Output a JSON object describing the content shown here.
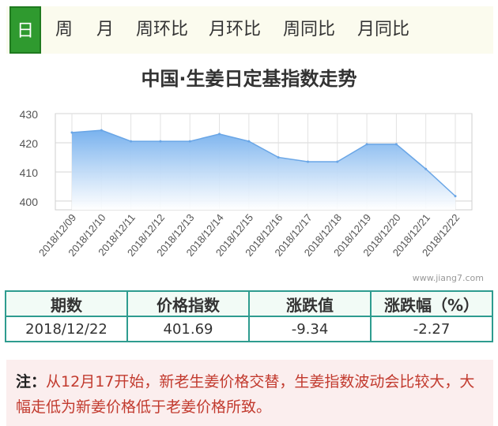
{
  "tabs": [
    {
      "label": "日",
      "active": true
    },
    {
      "label": "周",
      "active": false
    },
    {
      "label": "月",
      "active": false
    },
    {
      "label": "周环比",
      "active": false
    },
    {
      "label": "月环比",
      "active": false
    },
    {
      "label": "周同比",
      "active": false
    },
    {
      "label": "月同比",
      "active": false
    }
  ],
  "chart_data": {
    "type": "area",
    "title": "中国·生姜日定基指数走势",
    "x": [
      "2018/12/09",
      "2018/12/10",
      "2018/12/11",
      "2018/12/12",
      "2018/12/13",
      "2018/12/14",
      "2018/12/15",
      "2018/12/16",
      "2018/12/17",
      "2018/12/18",
      "2018/12/19",
      "2018/12/20",
      "2018/12/21",
      "2018/12/22"
    ],
    "series": [
      {
        "values": [
          423.5,
          424.3,
          420.5,
          420.5,
          420.5,
          423.0,
          420.5,
          415.0,
          413.5,
          413.5,
          419.5,
          419.5,
          411.0,
          401.7
        ]
      }
    ],
    "yticks": [
      400,
      410,
      420,
      430
    ],
    "ylim": [
      397,
      430
    ],
    "grid": true,
    "colors": {
      "line": "#6aa6e6",
      "fill_top": "#79b2ee",
      "fill_bottom": "#ffffff"
    }
  },
  "watermark": "www.jiang7.com",
  "summary": {
    "headers": [
      "期数",
      "价格指数",
      "涨跌值",
      "涨跌幅（%）"
    ],
    "row": [
      "2018/12/22",
      "401.69",
      "-9.34",
      "-2.27"
    ]
  },
  "note": {
    "label": "注：",
    "text": "从12月17开始，新老生姜价格交替，生姜指数波动会比较大，大幅走低为新姜价格低于老姜价格所致。"
  },
  "colors": {
    "tab_active": "#2f9a2f",
    "table_border": "#2e9c8f",
    "note_text": "#c23a2e",
    "note_bg": "#fbeeee"
  }
}
